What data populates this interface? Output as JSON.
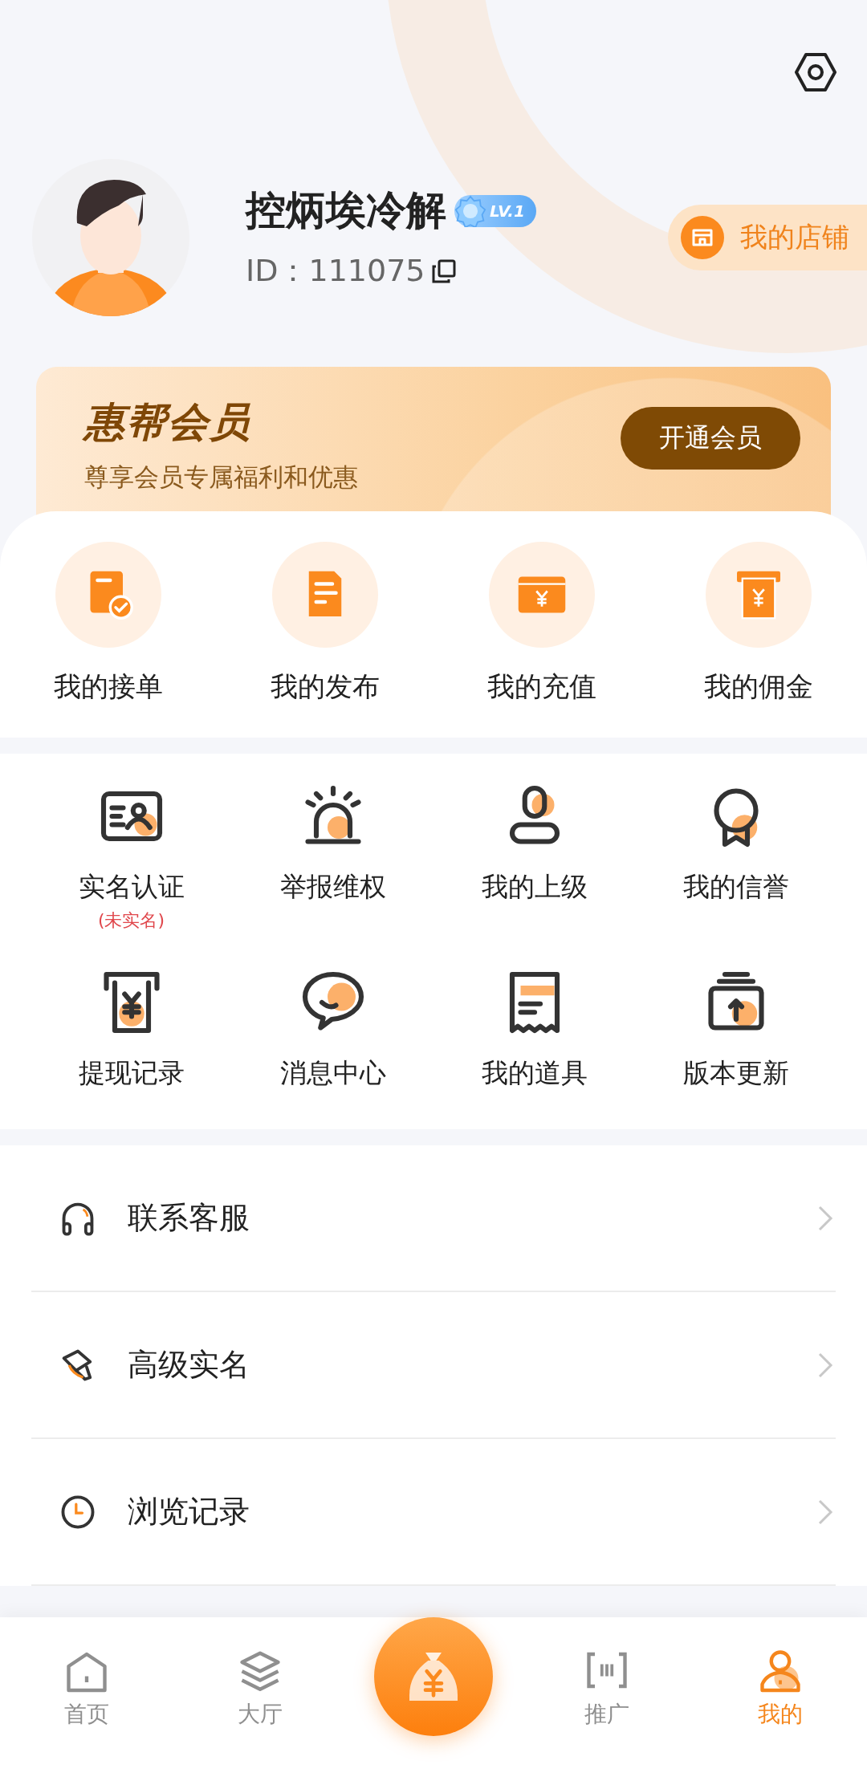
{
  "header": {
    "username": "控炳埃冷解",
    "level_badge": "LV.1",
    "user_id": "ID：111075",
    "store_button": "我的店铺"
  },
  "member_banner": {
    "title": "惠帮会员",
    "subtitle": "尊享会员专属福利和优惠",
    "button": "开通会员"
  },
  "quick_actions": [
    {
      "label": "我的接单"
    },
    {
      "label": "我的发布"
    },
    {
      "label": "我的充值"
    },
    {
      "label": "我的佣金"
    }
  ],
  "tools": [
    {
      "label": "实名认证",
      "note": "(未实名)"
    },
    {
      "label": "举报维权"
    },
    {
      "label": "我的上级"
    },
    {
      "label": "我的信誉"
    },
    {
      "label": "提现记录"
    },
    {
      "label": "消息中心"
    },
    {
      "label": "我的道具"
    },
    {
      "label": "版本更新"
    }
  ],
  "menu": [
    {
      "label": "联系客服"
    },
    {
      "label": "高级实名"
    },
    {
      "label": "浏览记录"
    }
  ],
  "tab_bar": {
    "items": [
      {
        "kind": "tab",
        "label": "首页",
        "selected": false
      },
      {
        "kind": "tab",
        "label": "大厅",
        "selected": false
      },
      {
        "kind": "center"
      },
      {
        "kind": "tab",
        "label": "推广",
        "selected": false
      },
      {
        "kind": "tab",
        "label": "我的",
        "selected": true
      }
    ]
  }
}
